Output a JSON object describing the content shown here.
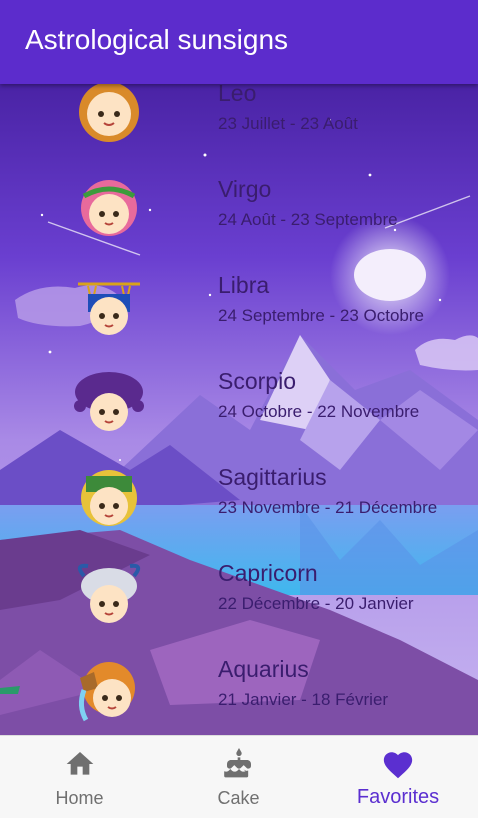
{
  "app_bar": {
    "title": "Astrological sunsigns"
  },
  "signs": [
    {
      "name": "Leo",
      "dates": "23 Juillet - 23 Août",
      "avatar_icon": "leo-avatar-icon"
    },
    {
      "name": "Virgo",
      "dates": "24 Août - 23 Septembre",
      "avatar_icon": "virgo-avatar-icon"
    },
    {
      "name": "Libra",
      "dates": "24 Septembre - 23 Octobre",
      "avatar_icon": "libra-avatar-icon"
    },
    {
      "name": "Scorpio",
      "dates": "24 Octobre - 22 Novembre",
      "avatar_icon": "scorpio-avatar-icon"
    },
    {
      "name": "Sagittarius",
      "dates": "23 Novembre - 21 Décembre",
      "avatar_icon": "sagittarius-avatar-icon"
    },
    {
      "name": "Capricorn",
      "dates": "22 Décembre - 20 Janvier",
      "avatar_icon": "capricorn-avatar-icon"
    },
    {
      "name": "Aquarius",
      "dates": "21 Janvier - 18 Février",
      "avatar_icon": "aquarius-avatar-icon"
    }
  ],
  "bottom_nav": {
    "items": [
      {
        "label": "Home",
        "icon": "home-icon",
        "active": false
      },
      {
        "label": "Cake",
        "icon": "cake-icon",
        "active": false
      },
      {
        "label": "Favorites",
        "icon": "heart-icon",
        "active": true
      }
    ]
  },
  "colors": {
    "primary": "#5c2ccc",
    "active_nav": "#5b2fd0",
    "inactive_nav": "#707070",
    "text": "#3a1d6e"
  }
}
